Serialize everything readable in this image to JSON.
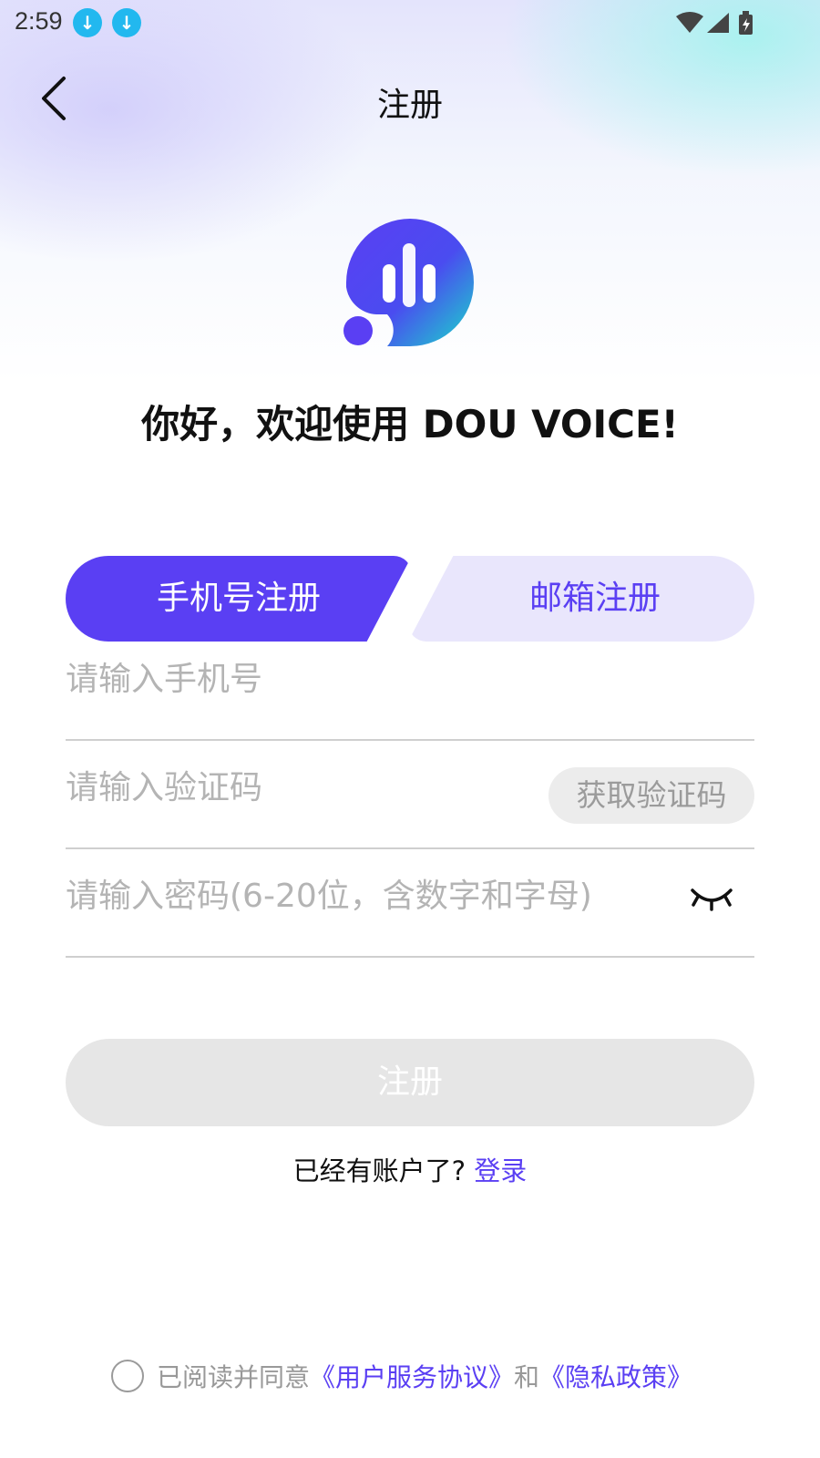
{
  "status_bar": {
    "time": "2:59"
  },
  "nav": {
    "title": "注册"
  },
  "welcome": {
    "text": "你好，欢迎使用 DOU VOICE!"
  },
  "tabs": {
    "phone_label": "手机号注册",
    "email_label": "邮箱注册",
    "active": "phone"
  },
  "form": {
    "phone_placeholder": "请输入手机号",
    "code_placeholder": "请输入验证码",
    "get_code_label": "获取验证码",
    "password_placeholder": "请输入密码(6-20位，含数字和字母)",
    "submit_label": "注册"
  },
  "login_prompt": {
    "text": "已经有账户了?",
    "link": "登录"
  },
  "agreement": {
    "prefix": "已阅读并同意",
    "terms": "《用户服务协议》",
    "and": "和",
    "privacy": "《隐私政策》"
  },
  "colors": {
    "accent": "#5a3ff3",
    "accent_light": "#e9e6fc",
    "logo_gradient_start": "#5a3ff3",
    "logo_gradient_end": "#19d9c9",
    "download_badge": "#22b8ef"
  },
  "icons": [
    "download-icon",
    "wifi-icon",
    "signal-icon",
    "battery-icon",
    "back-arrow-icon",
    "app-logo",
    "eye-closed-icon",
    "checkbox-circle-icon"
  ]
}
